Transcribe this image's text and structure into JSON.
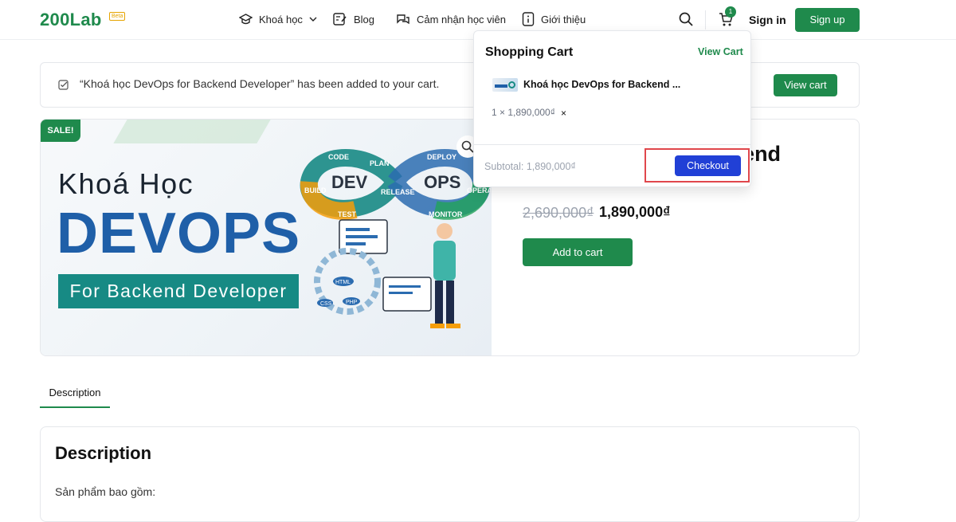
{
  "header": {
    "logo": "200Lab",
    "logo_badge": "Beta",
    "nav": [
      {
        "label": "Khoá học"
      },
      {
        "label": "Blog"
      },
      {
        "label": "Cảm nhận học viên"
      },
      {
        "label": "Giới thiệu"
      }
    ],
    "cart_count": "1",
    "signin": "Sign in",
    "signup": "Sign up"
  },
  "notice": {
    "text": "“Khoá học DevOps for Backend Developer” has been added to your cart.",
    "button": "View cart"
  },
  "product": {
    "sale_badge": "SALE!",
    "banner": {
      "line1": "Khoá Học",
      "line2": "DEVOPS",
      "line3": "For Backend Developer",
      "loop_left": "DEV",
      "loop_right": "OPS",
      "loop_labels": [
        "CODE",
        "PLAN",
        "BUILD",
        "TEST",
        "RELEASE",
        "DEPLOY",
        "OPERATE",
        "MONITOR"
      ],
      "gear_labels": [
        "HTML",
        "PHP",
        "CSS"
      ]
    },
    "title_fragment": "ackend",
    "old_price": "2,690,000₫",
    "new_price": "1,890,000₫",
    "add_to_cart": "Add to cart"
  },
  "tabs": [
    {
      "label": "Description"
    }
  ],
  "description": {
    "title": "Description",
    "text": "Sản phẩm bao gồm:"
  },
  "cart_popover": {
    "title": "Shopping Cart",
    "view_cart": "View Cart",
    "item_name": "Khoá học DevOps for Backend ...",
    "qty": "1 × 1,890,000₫",
    "remove": "×",
    "subtotal": "Subtotal: 1,890,000₫",
    "checkout": "Checkout"
  },
  "colors": {
    "brand_green": "#1f8a4c",
    "checkout_blue": "#2140d6",
    "highlight_red": "#e0474c",
    "devops_blue": "#1f5fa8",
    "teal": "#178a84"
  }
}
